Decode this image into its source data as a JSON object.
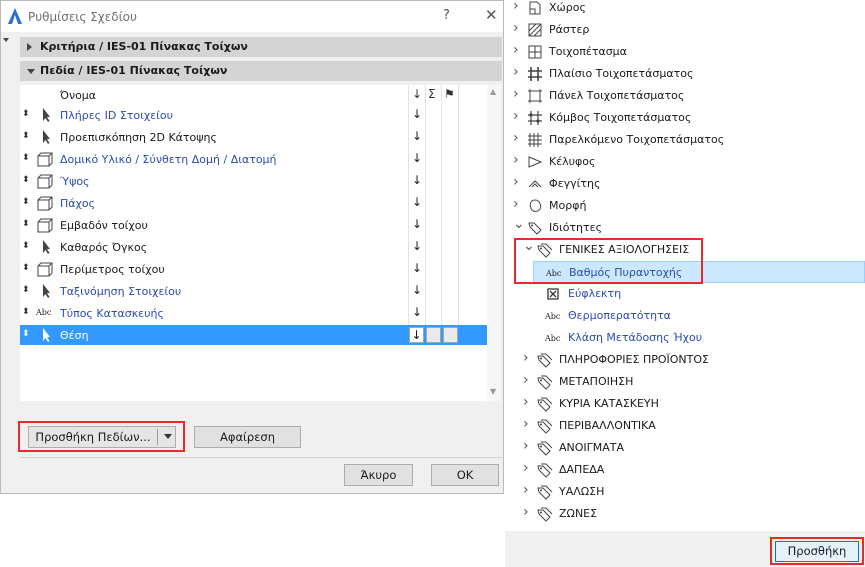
{
  "dialog": {
    "title": "Ρυθμίσεις Σχεδίου",
    "help": "?",
    "close": "✕",
    "sections": {
      "criteria": "Κριτήρια / IES-01 Πίνακας Τοίχων",
      "fields": "Πεδία / IES-01 Πίνακας Τοίχων"
    },
    "columns": {
      "name": "Όνομα",
      "sort_icon": "↓",
      "sum_icon": "Σ",
      "flag_icon": "⚑"
    },
    "rows": [
      {
        "label": "Πλήρες ID Στοιχείου",
        "icon": "arrow-pointer-icon",
        "linked": true,
        "sort": "↓"
      },
      {
        "label": "Προεπισκόπηση 2D Κάτοψης",
        "icon": "arrow-pointer-icon",
        "linked": false,
        "sort": "↓"
      },
      {
        "label": "Δομικό Υλικό / Σύνθετη Δομή / Διατομή",
        "icon": "wall-box-icon",
        "linked": true,
        "sort": "↓"
      },
      {
        "label": "Ύψος",
        "icon": "wall-box-icon",
        "linked": true,
        "sort": "↓"
      },
      {
        "label": "Πάχος",
        "icon": "wall-box-icon",
        "linked": true,
        "sort": "↓"
      },
      {
        "label": "Εμβαδόν τοίχου",
        "icon": "wall-box-icon",
        "linked": false,
        "sort": "↓"
      },
      {
        "label": "Καθαρός Όγκος",
        "icon": "arrow-pointer-icon",
        "linked": false,
        "sort": "↓"
      },
      {
        "label": "Περίμετρος τοίχου",
        "icon": "wall-box-icon",
        "linked": false,
        "sort": "↓"
      },
      {
        "label": "Ταξινόμηση Στοιχείου",
        "icon": "arrow-pointer-icon",
        "linked": true,
        "sort": "↓"
      },
      {
        "label": "Τύπος Κατασκευής",
        "icon": "abc-icon",
        "icon_text": "Abc",
        "linked": true,
        "sort": "↓"
      },
      {
        "label": "Θέση",
        "icon": "arrow-pointer-icon",
        "linked": false,
        "selected": true,
        "sort": "↓"
      }
    ],
    "buttons": {
      "add_fields": "Προσθήκη Πεδίων...",
      "remove": "Αφαίρεση",
      "cancel": "Άκυρο",
      "ok": "OK"
    }
  },
  "tree": {
    "abc_text": "Abc",
    "items": [
      {
        "label": "Χώρος",
        "level": 0,
        "state": "collapsed",
        "icon": "zone-icon"
      },
      {
        "label": "Ράστερ",
        "level": 0,
        "state": "collapsed",
        "icon": "grid-hatch-icon"
      },
      {
        "label": "Τοιχοπέτασμα",
        "level": 0,
        "state": "collapsed",
        "icon": "curtain-wall-icon"
      },
      {
        "label": "Πλαίσιο Τοιχοπετάσματος",
        "level": 0,
        "state": "collapsed",
        "icon": "frame-icon"
      },
      {
        "label": "Πάνελ Τοιχοπετάσματος",
        "level": 0,
        "state": "collapsed",
        "icon": "panel-icon"
      },
      {
        "label": "Κόμβος Τοιχοπετάσματος",
        "level": 0,
        "state": "collapsed",
        "icon": "junction-icon"
      },
      {
        "label": "Παρελκόμενο Τοιχοπετάσματος",
        "level": 0,
        "state": "collapsed",
        "icon": "accessory-icon"
      },
      {
        "label": "Κέλυφος",
        "level": 0,
        "state": "collapsed",
        "icon": "shell-icon"
      },
      {
        "label": "Φεγγίτης",
        "level": 0,
        "state": "collapsed",
        "icon": "skylight-icon"
      },
      {
        "label": "Μορφή",
        "level": 0,
        "state": "collapsed",
        "icon": "morph-icon"
      },
      {
        "label": "Ιδιότητες",
        "level": 0,
        "state": "expanded",
        "icon": "tag-icon"
      },
      {
        "label": "ΓΕΝΙΚΕΣ ΑΞΙΟΛΟΓΗΣΕΙΣ",
        "level": 1,
        "state": "expanded",
        "icon": "tags-icon"
      },
      {
        "label": "Βαθμός Πυραντοχής",
        "level": 2,
        "state": "leaf",
        "icon": "abc-icon",
        "highlighted": true
      },
      {
        "label": "Εύφλεκτη",
        "level": 2,
        "state": "leaf",
        "icon": "checkbox-icon"
      },
      {
        "label": "Θερμοπερατότητα",
        "level": 2,
        "state": "leaf",
        "icon": "abc-icon"
      },
      {
        "label": "Κλάση Μετάδοσης Ήχου",
        "level": 2,
        "state": "leaf",
        "icon": "abc-icon"
      },
      {
        "label": "ΠΛΗΡΟΦΟΡΙΕΣ ΠΡΟΪΟΝΤΟΣ",
        "level": 1,
        "state": "collapsed",
        "icon": "tags-icon"
      },
      {
        "label": "ΜΕΤΑΠΟΙΗΣΗ",
        "level": 1,
        "state": "collapsed",
        "icon": "tags-icon"
      },
      {
        "label": "ΚΥΡΙΑ ΚΑΤΑΣΚΕΥΗ",
        "level": 1,
        "state": "collapsed",
        "icon": "tags-icon"
      },
      {
        "label": "ΠΕΡΙΒΑΛΛΟΝΤΙΚΑ",
        "level": 1,
        "state": "collapsed",
        "icon": "tags-icon"
      },
      {
        "label": "ΑΝΟΙΓΜΑΤΑ",
        "level": 1,
        "state": "collapsed",
        "icon": "tags-icon"
      },
      {
        "label": "ΔΑΠΕΔΑ",
        "level": 1,
        "state": "collapsed",
        "icon": "tags-icon"
      },
      {
        "label": "ΥΑΛΩΣΗ",
        "level": 1,
        "state": "collapsed",
        "icon": "tags-icon"
      },
      {
        "label": "ΖΩΝΕΣ",
        "level": 1,
        "state": "collapsed",
        "icon": "tags-icon"
      }
    ],
    "add_button": "Προσθήκη"
  },
  "colors": {
    "link_blue": "#2a4cae",
    "selection": "#3399ff",
    "highlight": "#cce8ff",
    "callout_red": "#e32d2d"
  }
}
